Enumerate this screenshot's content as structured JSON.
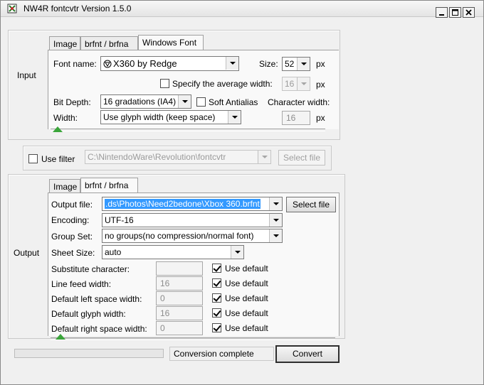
{
  "window": {
    "title": "NW4R fontcvtr Version 1.5.0",
    "controls": [
      "minimize-icon",
      "maximize-icon",
      "close-icon"
    ]
  },
  "input": {
    "group_label": "Input",
    "tabs": [
      "Image",
      "brfnt / brfna",
      "Windows Font"
    ],
    "active_tab": "Windows Font",
    "font_name_label": "Font name:",
    "font_name_value": "X360 by Redge",
    "size_label": "Size:",
    "size_value": "52",
    "size_unit": "px",
    "avg_width_label": "Specify the average width:",
    "avg_width_value": "16",
    "avg_width_unit": "px",
    "bit_depth_label": "Bit Depth:",
    "bit_depth_value": "16 gradations (IA4)",
    "soft_antialias_label": "Soft Antialias",
    "char_width_label": "Character width:",
    "width_label": "Width:",
    "width_value": "Use glyph width (keep space)",
    "char_width_value": "16",
    "char_width_unit": "px"
  },
  "filter": {
    "use_filter_label": "Use filter",
    "path_value": "C:\\NintendoWare\\Revolution\\fontcvtr",
    "select_file_label": "Select file"
  },
  "output": {
    "group_label": "Output",
    "tabs": [
      "Image",
      "brfnt / brfna"
    ],
    "active_tab": "brfnt / brfna",
    "output_file_label": "Output file:",
    "output_file_value": ".ds\\Photos\\Need2bedone\\Xbox 360.brfnt",
    "select_file_label": "Select file",
    "encoding_label": "Encoding:",
    "encoding_value": "UTF-16",
    "group_set_label": "Group Set:",
    "group_set_value": "no groups(no compression/normal font)",
    "sheet_size_label": "Sheet Size:",
    "sheet_size_value": "auto",
    "rows": [
      {
        "label": "Substitute character:",
        "value": "",
        "default_label": "Use default"
      },
      {
        "label": "Line feed width:",
        "value": "16",
        "default_label": "Use default"
      },
      {
        "label": "Default left space width:",
        "value": "0",
        "default_label": "Use default"
      },
      {
        "label": "Default glyph width:",
        "value": "16",
        "default_label": "Use default"
      },
      {
        "label": "Default right space width:",
        "value": "0",
        "default_label": "Use default"
      }
    ]
  },
  "status": {
    "progress": 0,
    "message": "Conversion complete",
    "convert_label": "Convert"
  }
}
